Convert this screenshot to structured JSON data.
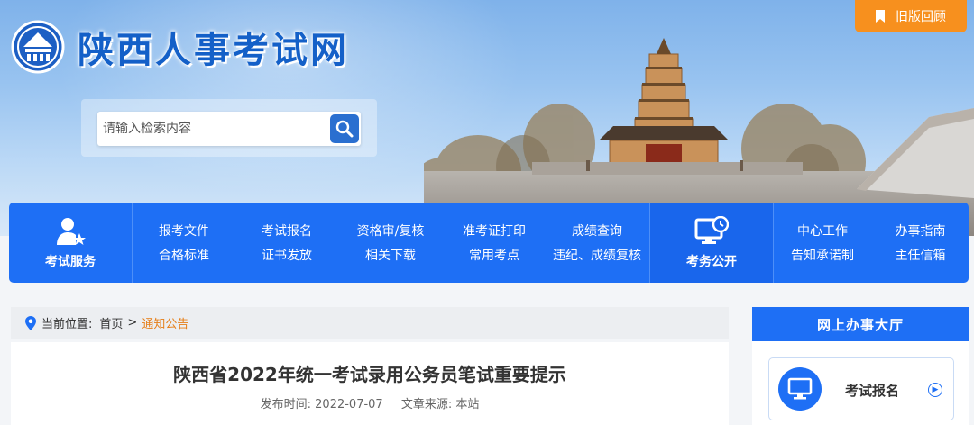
{
  "header": {
    "site_title": "陕西人事考试网",
    "old_version_label": "旧版回顾"
  },
  "search": {
    "placeholder": "请输入检索内容"
  },
  "nav": {
    "left_label": "考试服务",
    "group_a": [
      [
        "报考文件",
        "合格标准"
      ],
      [
        "考试报名",
        "证书发放"
      ],
      [
        "资格审/复核",
        "相关下载"
      ],
      [
        "准考证打印",
        "常用考点"
      ],
      [
        "成绩查询",
        "违纪、成绩复核"
      ]
    ],
    "mid_label": "考务公开",
    "group_b": [
      [
        "中心工作",
        "告知承诺制"
      ],
      [
        "办事指南",
        "主任信箱"
      ]
    ]
  },
  "breadcrumb": {
    "prefix": "当前位置:",
    "home": "首页",
    "separator": ">",
    "current": "通知公告"
  },
  "article": {
    "title": "陕西省2022年统一考试录用公务员笔试重要提示",
    "published": "发布时间: 2022-07-07",
    "source": "文章来源: 本站"
  },
  "sidebar": {
    "title": "网上办事大厅",
    "service_label": "考试报名"
  },
  "colors": {
    "primary": "#1e6ff5",
    "accent": "#f7901e",
    "breadcrumb_current": "#e67e17"
  }
}
